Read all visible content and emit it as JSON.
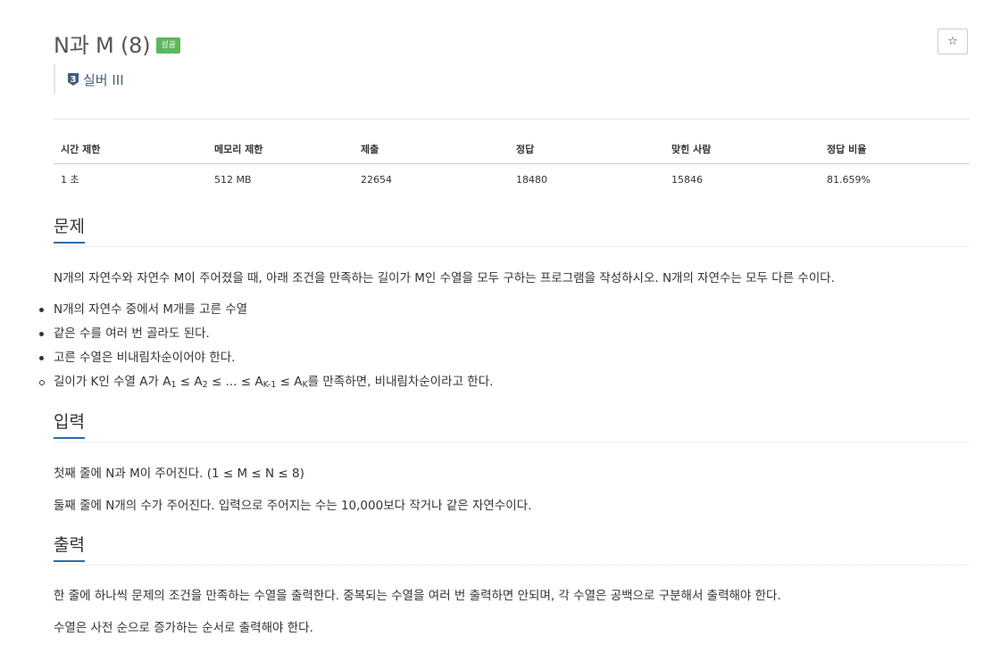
{
  "problem": {
    "title": "N과 M (8)",
    "status_badge": "성공",
    "star_label": "☆",
    "tier_number": "3",
    "tier_label": "실버 III"
  },
  "info_table": {
    "headers": [
      "시간 제한",
      "메모리 제한",
      "제출",
      "정답",
      "맞힌 사람",
      "정답 비율"
    ],
    "values": [
      "1 초",
      "512 MB",
      "22654",
      "18480",
      "15846",
      "81.659%"
    ]
  },
  "sections": {
    "description": {
      "heading": "문제",
      "text": "N개의 자연수와 자연수 M이 주어졌을 때, 아래 조건을 만족하는 길이가 M인 수열을 모두 구하는 프로그램을 작성하시오. N개의 자연수는 모두 다른 수이다.",
      "conditions": [
        "N개의 자연수 중에서 M개를 고른 수열",
        "같은 수를 여러 번 골라도 된다.",
        "고른 수열은 비내림차순이어야 한다."
      ],
      "subcondition": {
        "prefix": "길이가 K인 수열 A가 A",
        "s1": "1",
        "p2": " ≤ A",
        "s2": "2",
        "p3": " ≤ ... ≤ A",
        "s3": "K-1",
        "p4": " ≤ A",
        "s4": "K",
        "suffix": "를 만족하면, 비내림차순이라고 한다."
      }
    },
    "input": {
      "heading": "입력",
      "lines": [
        "첫째 줄에 N과 M이 주어진다. (1 ≤ M ≤ N ≤ 8)",
        "둘째 줄에 N개의 수가 주어진다. 입력으로 주어지는 수는 10,000보다 작거나 같은 자연수이다."
      ]
    },
    "output": {
      "heading": "출력",
      "lines": [
        "한 줄에 하나씩 문제의 조건을 만족하는 수열을 출력한다. 중복되는 수열을 여러 번 출력하면 안되며, 각 수열은 공백으로 구분해서 출력해야 한다.",
        "수열은 사전 순으로 증가하는 순서로 출력해야 한다."
      ]
    }
  },
  "colors": {
    "badge_success": "#5cb85c",
    "section_underline": "#2d6ca8",
    "tier_text": "#435f7a",
    "tier_icon": "#435f7a"
  },
  "icons": {
    "star": "star-icon",
    "tier": "silver-tier-shield-icon"
  }
}
